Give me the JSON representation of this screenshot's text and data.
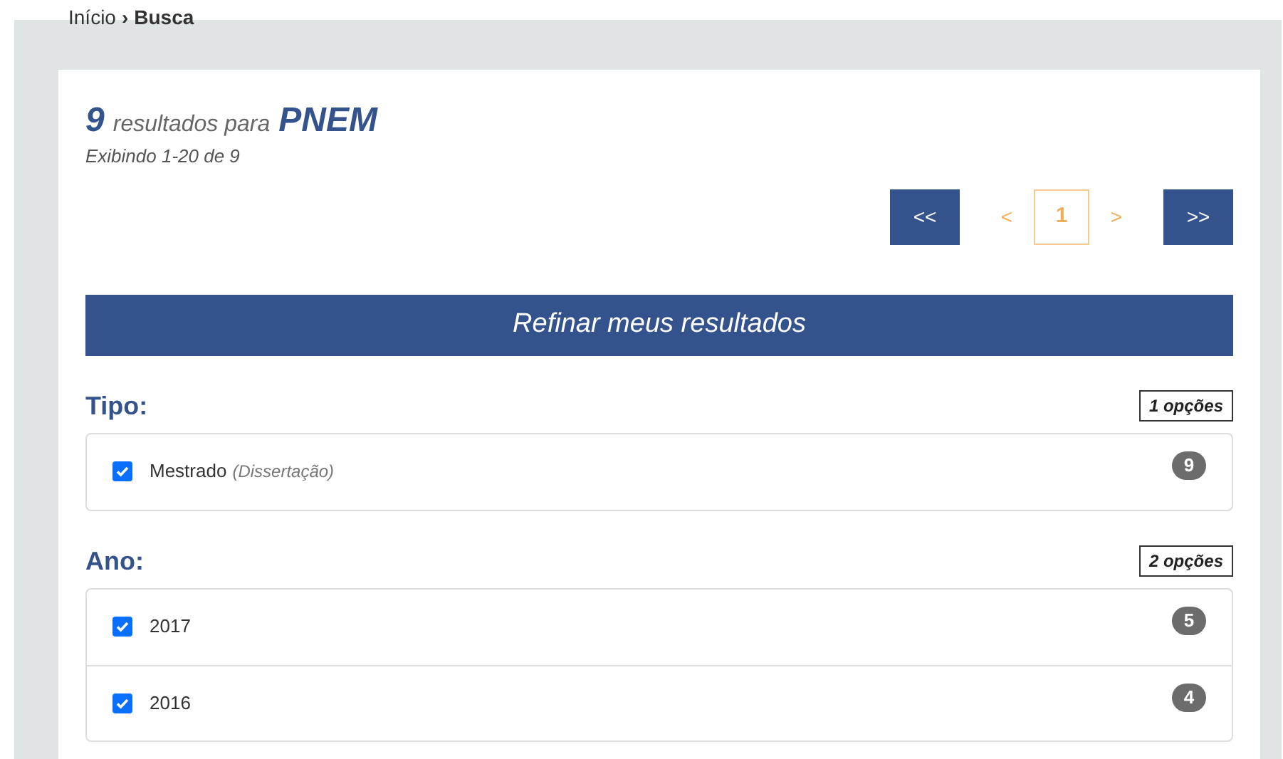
{
  "breadcrumb": [
    {
      "label": "Início",
      "current": false
    },
    {
      "label": "Busca",
      "current": true
    }
  ],
  "breadcrumb_separator": "›",
  "results": {
    "count": "9",
    "text": "resultados para",
    "query": "PNEM",
    "range": "Exibindo 1-20 de 9"
  },
  "pagination": [
    {
      "label": "<<",
      "kind": "jump"
    },
    {
      "label": "<",
      "kind": "arrow"
    },
    {
      "label": "1",
      "kind": "page",
      "selected": true
    },
    {
      "label": ">",
      "kind": "arrow"
    },
    {
      "label": ">>",
      "kind": "jump"
    }
  ],
  "refine_title": "Refinar meus resultados",
  "facets": [
    {
      "title": "Tipo:",
      "options_count": "1 opções",
      "items": [
        {
          "label": "Mestrado",
          "note": "(Dissertação)",
          "checked": true,
          "count": "9"
        }
      ]
    },
    {
      "title": "Ano:",
      "options_count": "2 opções",
      "items": [
        {
          "label": "2017",
          "checked": true,
          "count": "5"
        },
        {
          "label": "2016",
          "checked": true,
          "count": "4"
        }
      ]
    }
  ]
}
